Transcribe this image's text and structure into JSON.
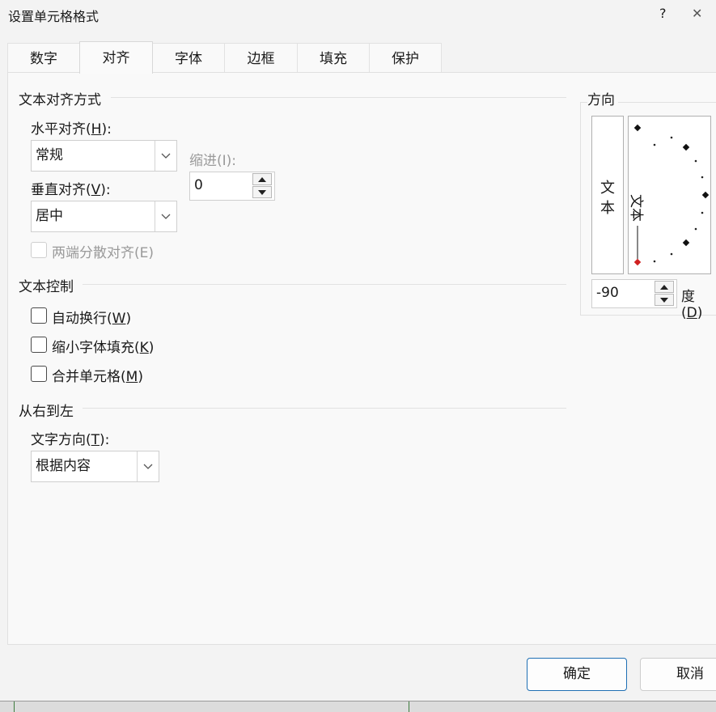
{
  "window": {
    "title": "设置单元格格式",
    "help": "?",
    "close": "✕"
  },
  "tabs": [
    {
      "label": "数字",
      "active": false
    },
    {
      "label": "对齐",
      "active": true
    },
    {
      "label": "字体",
      "active": false
    },
    {
      "label": "边框",
      "active": false
    },
    {
      "label": "填充",
      "active": false
    },
    {
      "label": "保护",
      "active": false
    }
  ],
  "text_alignment": {
    "heading": "文本对齐方式",
    "horizontal": {
      "prefix": "水平对齐(",
      "key": "H",
      "suffix": "):",
      "value": "常规"
    },
    "vertical": {
      "prefix": "垂直对齐(",
      "key": "V",
      "suffix": "):",
      "value": "居中"
    },
    "indent": {
      "label": "缩进(I):",
      "value": "0"
    },
    "distributed": {
      "label": "两端分散对齐(E)",
      "checked": false,
      "disabled": true
    }
  },
  "text_control": {
    "heading": "文本控制",
    "wrap_text": {
      "prefix": "自动换行(",
      "key": "W",
      "suffix": ")",
      "checked": false
    },
    "shrink_to_fit": {
      "prefix": "缩小字体填充(",
      "key": "K",
      "suffix": ")",
      "checked": false
    },
    "merge_cells": {
      "prefix": "合并单元格(",
      "key": "M",
      "suffix": ")",
      "checked": false
    }
  },
  "right_to_left": {
    "heading": "从右到左",
    "text_direction": {
      "prefix": "文字方向(",
      "key": "T",
      "suffix": "):",
      "value": "根据内容"
    }
  },
  "orientation": {
    "heading": "方向",
    "vertical_text": [
      "文",
      "本"
    ],
    "dial_text": "文本",
    "degrees": {
      "value": "-90",
      "prefix": "度(",
      "key": "D",
      "suffix": ")"
    },
    "marker_color": "#d02020"
  },
  "footer": {
    "ok": "确定",
    "cancel": "取消"
  },
  "colors": {
    "primary_border": "#1f6fb4"
  }
}
